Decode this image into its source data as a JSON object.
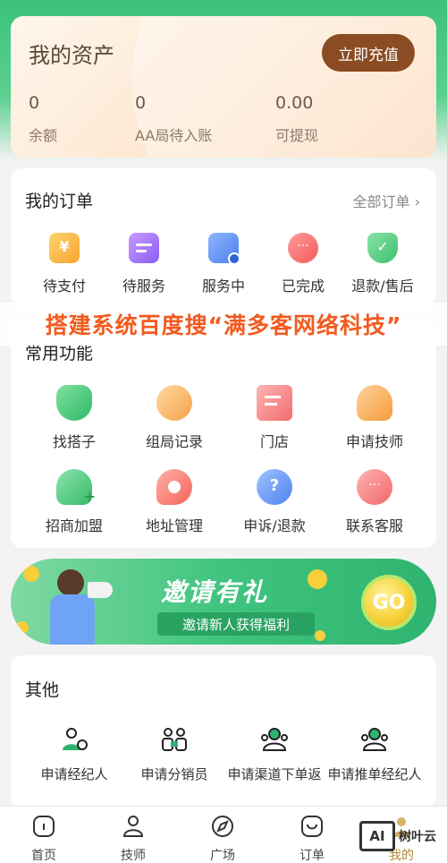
{
  "assets": {
    "title": "我的资产",
    "recharge": "立即充值",
    "stats": [
      {
        "value": "0",
        "label": "余额"
      },
      {
        "value": "0",
        "label": "AA局待入账"
      },
      {
        "value": "0.00",
        "label": "可提现"
      }
    ]
  },
  "orders": {
    "title": "我的订单",
    "all": "全部订单",
    "items": [
      {
        "label": "待支付",
        "icon": "yen-card-icon"
      },
      {
        "label": "待服务",
        "icon": "service-card-icon"
      },
      {
        "label": "服务中",
        "icon": "clipboard-check-icon"
      },
      {
        "label": "已完成",
        "icon": "chat-bubbles-icon"
      },
      {
        "label": "退款/售后",
        "icon": "shield-check-icon"
      }
    ]
  },
  "promo": "搭建系统百度搜“满多客网络科技”",
  "common": {
    "title": "常用功能",
    "items": [
      {
        "label": "找搭子",
        "icon": "handshake-icon"
      },
      {
        "label": "组局记录",
        "icon": "group-record-icon"
      },
      {
        "label": "门店",
        "icon": "store-doc-icon"
      },
      {
        "label": "申请技师",
        "icon": "technician-icon"
      },
      {
        "label": "招商加盟",
        "icon": "add-user-icon"
      },
      {
        "label": "地址管理",
        "icon": "address-icon"
      },
      {
        "label": "申诉/退款",
        "icon": "question-icon"
      },
      {
        "label": "联系客服",
        "icon": "customer-service-icon"
      }
    ]
  },
  "invite": {
    "title": "邀请有礼",
    "subtitle": "邀请新人获得福利",
    "go": "GO"
  },
  "others": {
    "title": "其他",
    "items": [
      {
        "label": "申请经纪人"
      },
      {
        "label": "申请分销员"
      },
      {
        "label": "申请渠道下单返"
      },
      {
        "label": "申请推单经纪人"
      }
    ]
  },
  "nav": {
    "items": [
      {
        "label": "首页"
      },
      {
        "label": "技师"
      },
      {
        "label": "广场"
      },
      {
        "label": "订单"
      },
      {
        "label": "我的"
      }
    ]
  },
  "watermark": {
    "box": "AI",
    "text": "树叶云"
  },
  "colors": {
    "brand_green": "#3bc27a",
    "recharge_brown": "#8a4c23",
    "promo_orange": "#f25a1f"
  }
}
